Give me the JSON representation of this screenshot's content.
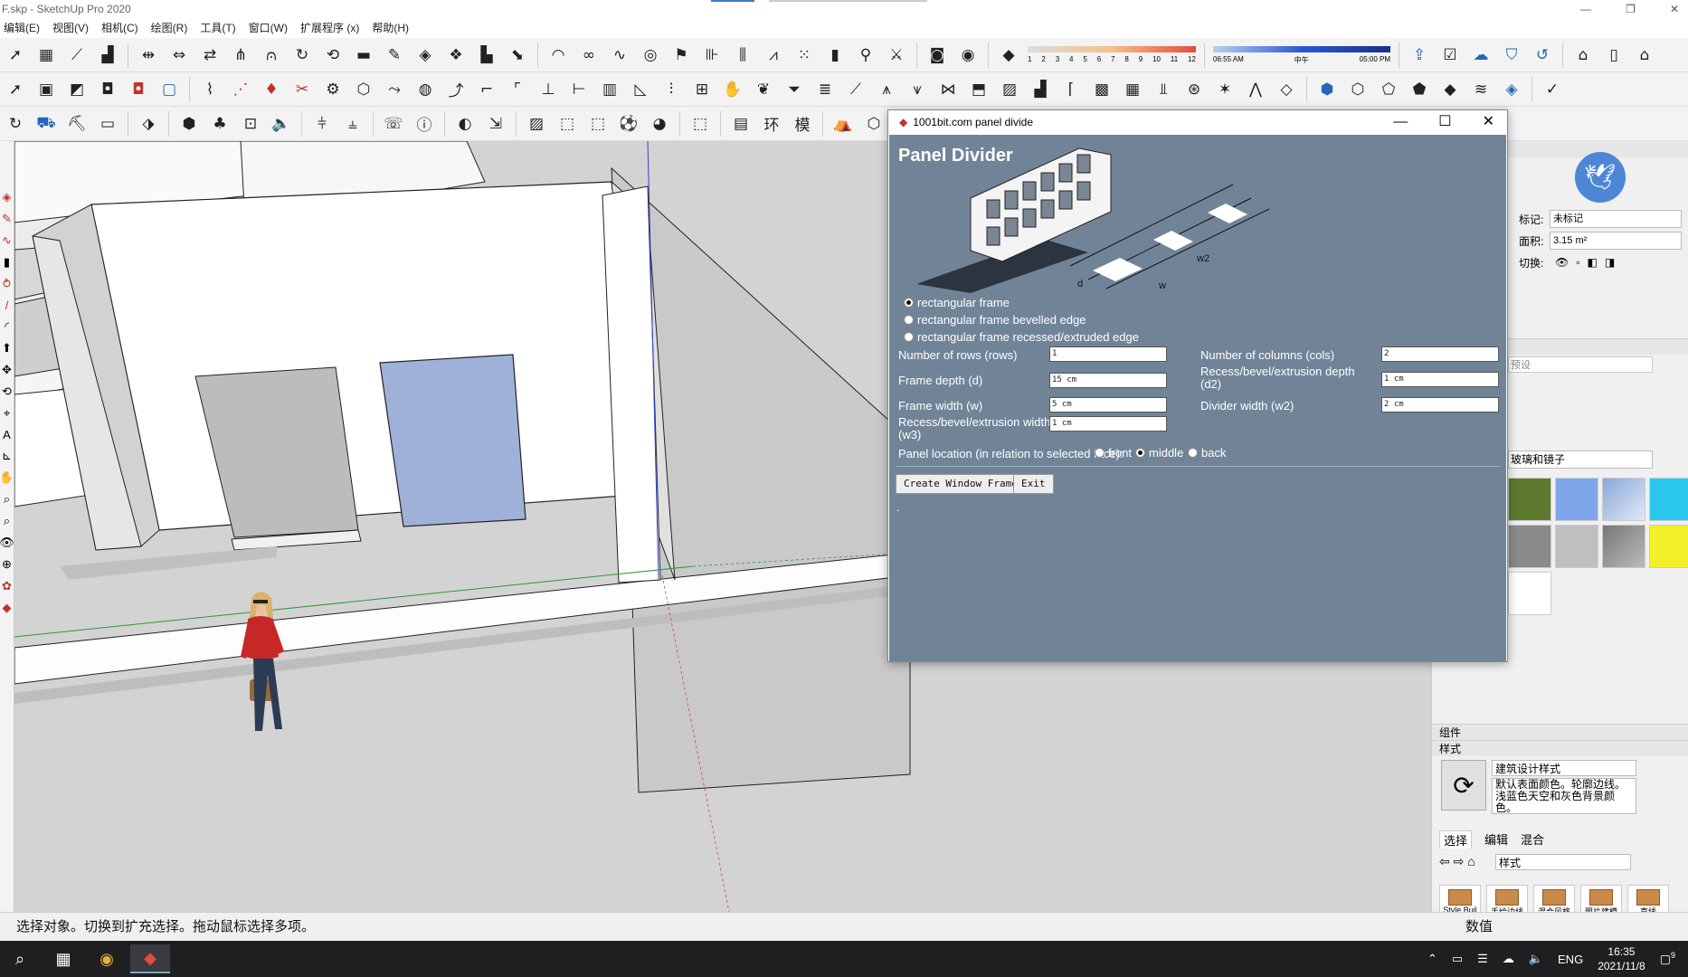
{
  "window": {
    "title": "F.skp - SketchUp Pro 2020",
    "controls": [
      "—",
      "❐",
      "✕"
    ]
  },
  "menu": [
    "编辑(E)",
    "视图(V)",
    "相机(C)",
    "绘图(R)",
    "工具(T)",
    "窗口(W)",
    "扩展程序 (x)",
    "帮助(H)"
  ],
  "shadow_bar": {
    "months": [
      "1",
      "2",
      "3",
      "4",
      "5",
      "6",
      "7",
      "8",
      "9",
      "10",
      "11",
      "12"
    ],
    "time_start": "06:55 AM",
    "time_mid": "中午",
    "time_end": "05:00 PM"
  },
  "dialog": {
    "title": "1001bit.com panel divide",
    "heading": "Panel Divider",
    "diagram_labels": {
      "d": "d",
      "w": "w",
      "w2": "w2"
    },
    "frame_options": [
      {
        "label": "rectangular frame",
        "selected": true
      },
      {
        "label": "rectangular frame bevelled edge",
        "selected": false
      },
      {
        "label": "rectangular frame recessed/extruded edge",
        "selected": false
      }
    ],
    "params": {
      "rows_label": "Number of rows (rows)",
      "rows_value": "1",
      "cols_label": "Number of columns (cols)",
      "cols_value": "2",
      "depth_label": "Frame depth (d)",
      "depth_value": "15 cm",
      "d2_label_1": "Recess/bevel/extrusion depth",
      "d2_label_2": "(d2)",
      "d2_value": "1 cm",
      "width_label": "Frame width (w)",
      "width_value": "5 cm",
      "w2_label": "Divider width (w2)",
      "w2_value": "2 cm",
      "w3_label_1": "Recess/bevel/extrusion width",
      "w3_label_2": "(w3)",
      "w3_value": "1 cm"
    },
    "location": {
      "label": "Panel location (in relation to selected face):",
      "options": [
        {
          "label": "front",
          "selected": false
        },
        {
          "label": "middle",
          "selected": true
        },
        {
          "label": "back",
          "selected": false
        }
      ]
    },
    "create_button": "Create Window Frame",
    "exit_button": "Exit",
    "footer_dot": "."
  },
  "entity_info": {
    "tag_label": "标记:",
    "tag_value": "未标记",
    "area_label": "面积:",
    "area_value": "3.15 m²",
    "toggle_label": "切换:"
  },
  "materials": {
    "preset_label": "预设",
    "library": "玻璃和镜子"
  },
  "panels": {
    "components": "组件",
    "styles": "样式"
  },
  "styles": {
    "name": "建筑设计样式",
    "description": "默认表面颜色。轮廓边线。浅蓝色天空和灰色背景颜色。",
    "tabs": [
      "选择",
      "编辑",
      "混合"
    ],
    "library": "样式",
    "thumbs": [
      "Style Buil",
      "手绘边线",
      "混合风格",
      "照片建模",
      "直线"
    ]
  },
  "status": {
    "hint": "选择对象。切换到扩充选择。拖动鼠标选择多项。",
    "value_label": "数值"
  },
  "taskbar": {
    "lang": "ENG",
    "time": "16:35",
    "date": "2021/11/8",
    "notify_count": "9"
  },
  "colors": {
    "dialog_bg": "#718497",
    "selected_face": "#9fb1d8",
    "brand_red": "#c0342c"
  }
}
